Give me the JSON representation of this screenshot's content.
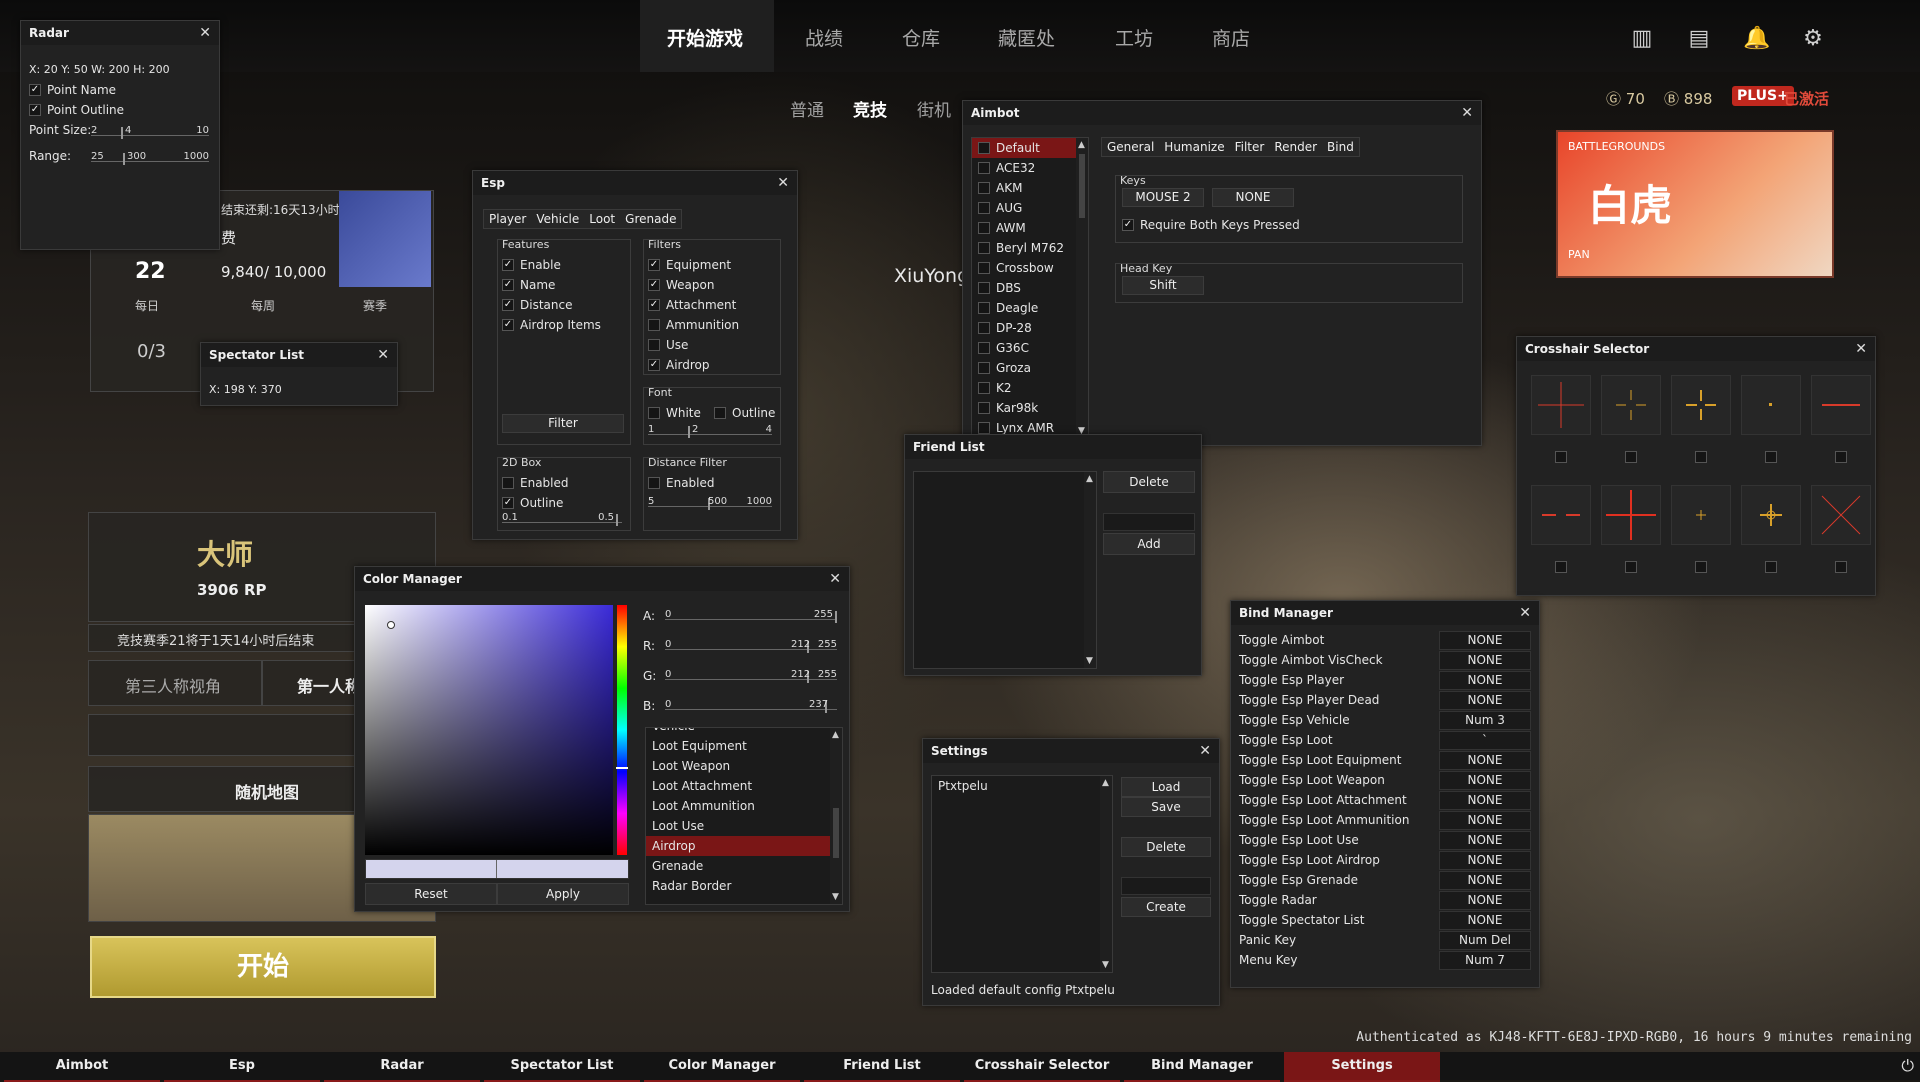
{
  "game": {
    "nav_tabs": [
      "开始游戏",
      "战绩",
      "仓库",
      "藏匿处",
      "工坊",
      "商店"
    ],
    "sub_tabs": [
      "普通",
      "竞技",
      "街机"
    ],
    "gcoin": "70",
    "bp": "898",
    "plus_badge": "PLUS+",
    "plus_status": "已激活",
    "player_name": "XiuYong",
    "level": "22",
    "xp": "9,840/ 10,000",
    "season_end": "结束还剩:16天13小时",
    "fee_label": "费",
    "missions": [
      "每日",
      "每周",
      "赛季"
    ],
    "mission_progress": "0/3",
    "rank_name": "大师",
    "rank_rp": "3906 RP",
    "season_notice": "竞技赛季21将于1天14小时后结束",
    "view_modes": [
      "第三人称视角",
      "第一人称"
    ],
    "map_label": "随机地图",
    "start_label": "开始",
    "banner_title": "白虎",
    "banner_sub": "BATTLEGROUNDS",
    "banner_name": "PAN"
  },
  "radar": {
    "title": "Radar",
    "pos_text": "X: 20 Y: 50 W: 200 H: 200",
    "point_name": "Point Name",
    "point_outline": "Point Outline",
    "point_size_label": "Point Size:",
    "point_size": {
      "min": "2",
      "val": "4",
      "max": "10"
    },
    "range_label": "Range:",
    "range": {
      "min": "25",
      "val": "300",
      "max": "1000"
    }
  },
  "spectator": {
    "title": "Spectator List",
    "pos_text": "X: 198 Y: 370"
  },
  "esp": {
    "title": "Esp",
    "tabs": [
      "Player",
      "Vehicle",
      "Loot",
      "Grenade"
    ],
    "features_label": "Features",
    "features": [
      {
        "label": "Enable",
        "checked": true
      },
      {
        "label": "Name",
        "checked": true
      },
      {
        "label": "Distance",
        "checked": true
      },
      {
        "label": "Airdrop Items",
        "checked": true
      }
    ],
    "filter_button": "Filter",
    "filters_label": "Filters",
    "filters": [
      {
        "label": "Equipment",
        "checked": true
      },
      {
        "label": "Weapon",
        "checked": true
      },
      {
        "label": "Attachment",
        "checked": true
      },
      {
        "label": "Ammunition",
        "checked": false
      },
      {
        "label": "Use",
        "checked": false
      },
      {
        "label": "Airdrop",
        "checked": true
      }
    ],
    "font_label": "Font",
    "font_white": "White",
    "font_outline": "Outline",
    "font_slider": {
      "min": "1",
      "val": "2",
      "max": "4"
    },
    "box_label": "2D Box",
    "box_enabled": "Enabled",
    "box_outline": "Outline",
    "box_slider": {
      "min": "0.1",
      "max": "0.5"
    },
    "dist_label": "Distance Filter",
    "dist_enabled": "Enabled",
    "dist_slider": {
      "min": "5",
      "val": "500",
      "max": "1000"
    }
  },
  "aimbot": {
    "title": "Aimbot",
    "weapons": [
      "Default",
      "ACE32",
      "AKM",
      "AUG",
      "AWM",
      "Beryl M762",
      "Crossbow",
      "DBS",
      "Deagle",
      "DP-28",
      "G36C",
      "Groza",
      "K2",
      "Kar98k",
      "Lynx AMR"
    ],
    "tabs": [
      "General",
      "Humanize",
      "Filter",
      "Render",
      "Bind"
    ],
    "keys_label": "Keys",
    "key1": "MOUSE 2",
    "key2": "NONE",
    "require_both": "Require Both Keys Pressed",
    "head_key_label": "Head Key",
    "head_key": "Shift"
  },
  "friend_list": {
    "title": "Friend List",
    "delete": "Delete",
    "add": "Add"
  },
  "crosshair": {
    "title": "Crosshair Selector"
  },
  "color_manager": {
    "title": "Color Manager",
    "channels": [
      {
        "label": "A:",
        "min": "0",
        "val": "",
        "max": "255"
      },
      {
        "label": "R:",
        "min": "0",
        "val": "212",
        "max": "255"
      },
      {
        "label": "G:",
        "min": "0",
        "val": "212",
        "max": "255"
      },
      {
        "label": "B:",
        "min": "0",
        "val": "237",
        "max": ""
      }
    ],
    "items": [
      "Vehicle",
      "Loot Equipment",
      "Loot Weapon",
      "Loot Attachment",
      "Loot Ammunition",
      "Loot Use",
      "Airdrop",
      "Grenade",
      "Radar Border"
    ],
    "selected": "Airdrop",
    "reset": "Reset",
    "apply": "Apply",
    "accent": "#7a1616"
  },
  "bind_manager": {
    "title": "Bind Manager",
    "binds": [
      {
        "name": "Toggle Aimbot",
        "key": "NONE"
      },
      {
        "name": "Toggle Aimbot VisCheck",
        "key": "NONE"
      },
      {
        "name": "Toggle Esp Player",
        "key": "NONE"
      },
      {
        "name": "Toggle Esp Player Dead",
        "key": "NONE"
      },
      {
        "name": "Toggle Esp Vehicle",
        "key": "Num 3"
      },
      {
        "name": "Toggle Esp Loot",
        "key": "`"
      },
      {
        "name": "Toggle Esp Loot Equipment",
        "key": "NONE"
      },
      {
        "name": "Toggle Esp Loot Weapon",
        "key": "NONE"
      },
      {
        "name": "Toggle Esp Loot Attachment",
        "key": "NONE"
      },
      {
        "name": "Toggle Esp Loot Ammunition",
        "key": "NONE"
      },
      {
        "name": "Toggle Esp Loot Use",
        "key": "NONE"
      },
      {
        "name": "Toggle Esp Loot Airdrop",
        "key": "NONE"
      },
      {
        "name": "Toggle Esp Grenade",
        "key": "NONE"
      },
      {
        "name": "Toggle Radar",
        "key": "NONE"
      },
      {
        "name": "Toggle Spectator List",
        "key": "NONE"
      },
      {
        "name": "Panic Key",
        "key": "Num Del"
      },
      {
        "name": "Menu Key",
        "key": "Num 7"
      }
    ]
  },
  "settings": {
    "title": "Settings",
    "configs": [
      "Ptxtpelu"
    ],
    "load": "Load",
    "save": "Save",
    "delete": "Delete",
    "create": "Create",
    "status": "Loaded default config Ptxtpelu"
  },
  "taskbar": {
    "items": [
      "Aimbot",
      "Esp",
      "Radar",
      "Spectator List",
      "Color Manager",
      "Friend List",
      "Crosshair Selector",
      "Bind Manager",
      "Settings"
    ],
    "active": "Settings",
    "auth": "Authenticated as KJ48-KFTT-6E8J-IPXD-RGB0, 16 hours 9 minutes remaining"
  },
  "colors": {
    "accent_red": "#7a1616",
    "gold": "#d9c47a",
    "crosshair_red": "#d83a2a"
  }
}
